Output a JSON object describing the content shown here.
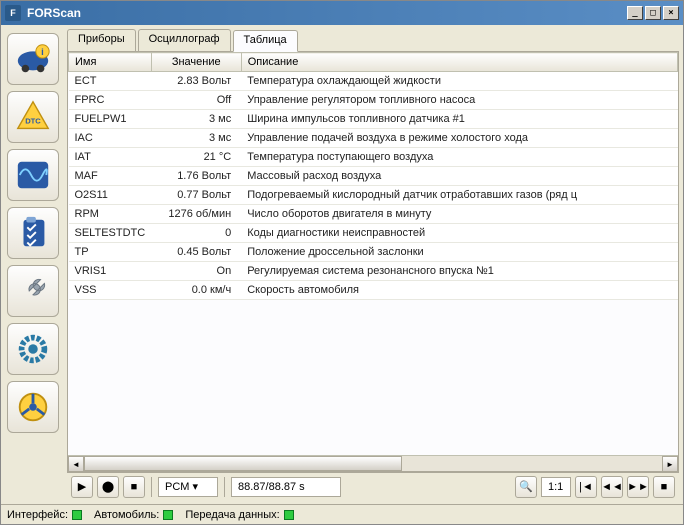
{
  "title": "FORScan",
  "tabs": [
    {
      "label": "Приборы"
    },
    {
      "label": "Осциллограф"
    },
    {
      "label": "Таблица"
    }
  ],
  "active_tab": 2,
  "table": {
    "headers": {
      "name": "Имя",
      "value": "Значение",
      "desc": "Описание"
    },
    "rows": [
      {
        "name": "ECT",
        "value": "2.83 Вольт",
        "desc": "Температура охлаждающей жидкости"
      },
      {
        "name": "FPRC",
        "value": "Off",
        "desc": "Управление регулятором топливного насоса"
      },
      {
        "name": "FUELPW1",
        "value": "3 мс",
        "desc": "Ширина импульсов топливного датчика #1"
      },
      {
        "name": "IAC",
        "value": "3 мс",
        "desc": "Управление подачей воздуха в режиме холостого хода"
      },
      {
        "name": "IAT",
        "value": "21 °C",
        "desc": "Температура поступающего воздуха"
      },
      {
        "name": "MAF",
        "value": "1.76 Вольт",
        "desc": "Массовый расход воздуха"
      },
      {
        "name": "O2S11",
        "value": "0.77 Вольт",
        "desc": "Подогреваемый кислородный датчик отработавших газов (ряд ц"
      },
      {
        "name": "RPM",
        "value": "1276 об/мин",
        "desc": "Число оборотов двигателя в минуту"
      },
      {
        "name": "SELTESTDTC",
        "value": "0",
        "desc": "Коды диагностики неисправностей"
      },
      {
        "name": "TP",
        "value": "0.45 Вольт",
        "desc": "Положение дроссельной заслонки"
      },
      {
        "name": "VRIS1",
        "value": "On",
        "desc": "Регулируемая система резонансного впуска №1"
      },
      {
        "name": "VSS",
        "value": "0.0 км/ч",
        "desc": "Скорость автомобиля"
      }
    ]
  },
  "toolbar": {
    "module": "PCM",
    "time": "88.87/88.87 s",
    "zoom": "1:1"
  },
  "status": {
    "interface_label": "Интерфейс:",
    "car_label": "Автомобиль:",
    "data_label": "Передача данных:"
  }
}
